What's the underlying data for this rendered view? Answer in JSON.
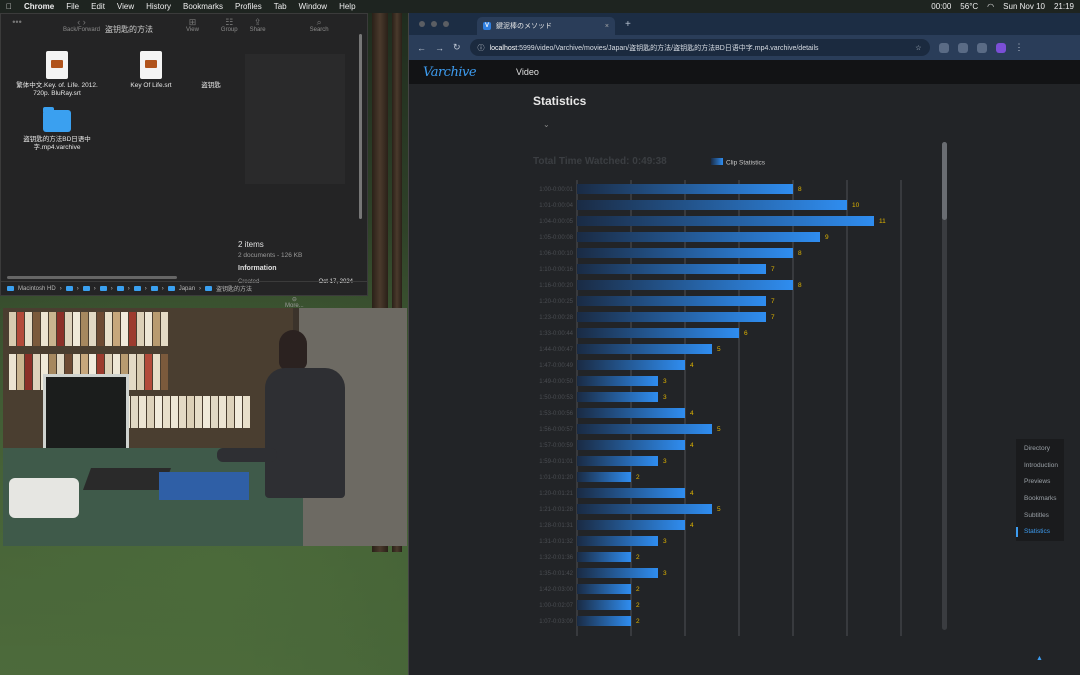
{
  "menubar": {
    "app": "Chrome",
    "items": [
      "File",
      "Edit",
      "View",
      "History",
      "Bookmarks",
      "Profiles",
      "Tab",
      "Window",
      "Help"
    ],
    "status": [
      "00:00",
      "56°C",
      "Sun Nov 10",
      "21:19"
    ]
  },
  "finder": {
    "title": "盗钥匙的方法",
    "toolbar": [
      "Back/Forward",
      "View",
      "Group",
      "Share",
      "Search"
    ],
    "files": [
      {
        "name": "繁体中文.Key. of. Life. 2012. 720p. BluRay.srt",
        "kind": "doc"
      },
      {
        "name": "Key Of Life.srt",
        "kind": "doc"
      },
      {
        "name": "盗钥匙",
        "kind": "text"
      },
      {
        "name": "盗钥匙的方法BD日语中字.mp4.varchive",
        "kind": "folder"
      }
    ],
    "preview": {
      "count": "2 items",
      "sub": "2 documents - 126 KB",
      "info_label": "Information",
      "created_label": "Created",
      "created_value": "Oct 17, 2024",
      "more": "More..."
    },
    "path": [
      "Macintosh HD",
      "Japan",
      "盗钥匙的方法"
    ]
  },
  "browser": {
    "tab_title": "鍵泥棒のメソッド",
    "url_host": "localhost",
    "url_rest": ":5999/video/Varchive/movies/Japan/盗钥匙的方法/盗钥匙的方法BD日语中字.mp4.varchive/details",
    "logo": "Varchive",
    "nav_video": "Video",
    "page_title": "Statistics",
    "chev": "⌄",
    "toc": [
      "Directory",
      "Introduction",
      "Previews",
      "Bookmarks",
      "Subtitles",
      "Statistics"
    ]
  },
  "chart_data": {
    "type": "bar",
    "orientation": "horizontal",
    "title": "Total Time Watched: 0:49:38",
    "legend": "Clip Statistics",
    "series": [
      {
        "name": "Clip Statistics",
        "values": [
          8,
          10,
          11,
          9,
          8,
          7,
          8,
          7,
          7,
          6,
          5,
          4,
          3,
          3,
          4,
          5,
          4,
          3,
          2,
          4,
          5,
          4,
          3,
          2,
          3,
          2,
          2,
          2
        ]
      }
    ],
    "categories": [
      "1:00-0:00:01",
      "1:01-0:00:04",
      "1:04-0:00:05",
      "1:05-0:00:08",
      "1:06-0:00:10",
      "1:10-0:00:16",
      "1:16-0:00:20",
      "1:20-0:00:25",
      "1:23-0:00:28",
      "1:33-0:00:44",
      "1:44-0:00:47",
      "1:47-0:00:49",
      "1:49-0:00:50",
      "1:50-0:00:53",
      "1:53-0:00:56",
      "1:56-0:00:57",
      "1:57-0:00:59",
      "1:59-0:01:01",
      "1:01-0:01:20",
      "1:20-0:01:21",
      "1:21-0:01:28",
      "1:28-0:01:31",
      "1:31-0:01:32",
      "1:32-0:01:36",
      "1:35-0:01:42",
      "1:42-0:03:00",
      "1:00-0:02:07",
      "1:07-0:03:09"
    ],
    "xlim": [
      0,
      12
    ],
    "grid": true,
    "bar_color": "#2f8df0",
    "label_color": "#e0b400"
  }
}
